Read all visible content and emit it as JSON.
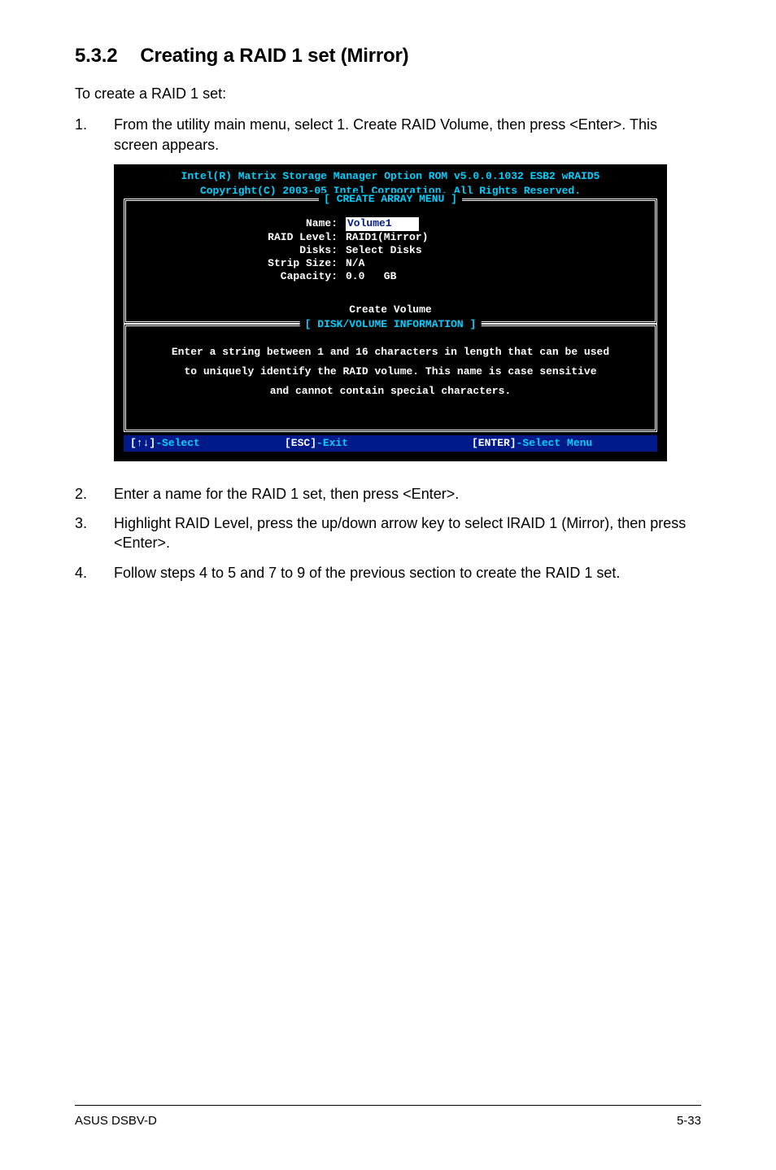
{
  "section": {
    "number": "5.3.2",
    "title": "Creating a RAID 1 set (Mirror)"
  },
  "intro": "To create a RAID 1 set:",
  "step1": {
    "num": "1.",
    "text": "From the utility main menu, select 1. Create RAID Volume, then press <Enter>. This screen appears."
  },
  "bios": {
    "title_line1": "Intel(R) Matrix Storage Manager Option ROM v5.0.0.1032 ESB2 wRAID5",
    "title_line2": "Copyright(C) 2003-05 Intel Corporation. All Rights Reserved.",
    "frame1_label": "[ CREATE ARRAY MENU ]",
    "fields": {
      "name_label": "Name:",
      "name_value": "Volume1",
      "raid_level_label": "RAID Level:",
      "raid_level_value": "RAID1(Mirror)",
      "disks_label": "Disks:",
      "disks_value": "Select Disks",
      "strip_label": "Strip Size:",
      "strip_value": "N/A",
      "capacity_label": "Capacity:",
      "capacity_value": "0.0   GB"
    },
    "create_volume": "Create Volume",
    "frame2_label": "[ DISK/VOLUME INFORMATION ]",
    "info_line1": "Enter a string between 1 and 16 characters in length that can be used",
    "info_line2": "to uniquely identify the RAID volume. This name is case sensitive",
    "info_line3": "and cannot contain special characters.",
    "footer_select_keys": "[↑↓]",
    "footer_select_text": "-Select",
    "footer_esc_keys": "[ESC]",
    "footer_esc_text": "-Exit",
    "footer_enter_keys": "[ENTER]",
    "footer_enter_text": "-Select Menu"
  },
  "step2": {
    "num": "2.",
    "text": "Enter a name for the RAID 1 set, then press <Enter>."
  },
  "step3": {
    "num": "3.",
    "text": "Highlight RAID Level, press the up/down arrow key to select lRAID 1 (Mirror), then press <Enter>."
  },
  "step4": {
    "num": "4.",
    "text": "Follow steps 4 to 5 and 7 to 9 of the previous section to create the RAID 1 set."
  },
  "footer": {
    "left": "ASUS DSBV-D",
    "right": "5-33"
  }
}
